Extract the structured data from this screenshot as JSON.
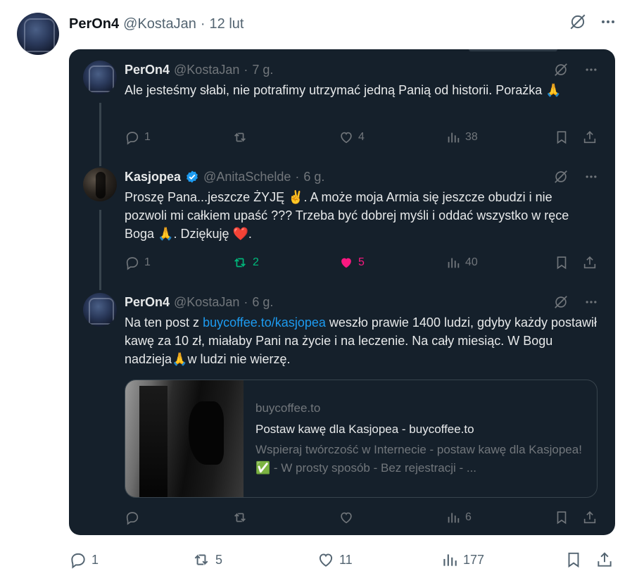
{
  "outer": {
    "name": "PerOn4",
    "handle": "@KostaJan",
    "sep": "·",
    "date": "12 lut",
    "replies": "1",
    "reposts": "5",
    "likes": "11",
    "views": "177"
  },
  "replies": [
    {
      "name": "PerOn4",
      "handle": "@KostaJan",
      "sep": "·",
      "time": "7 g.",
      "text": "Ale jesteśmy słabi, nie potrafimy utrzymać jedną Panią od historii. Porażka 🙏",
      "replies": "1",
      "reposts": "",
      "likes": "4",
      "views": "38"
    },
    {
      "name": "Kasjopea",
      "handle": "@AnitaSchelde",
      "sep": "·",
      "time": "6 g.",
      "text": "Proszę Pana...jeszcze ŻYJĘ ✌️. A może moja Armia się jeszcze obudzi i nie pozwoli mi całkiem upaść  ??? Trzeba być dobrej myśli i oddać wszystko w ręce Boga 🙏. Dziękuję ❤️.",
      "replies": "1",
      "reposts": "2",
      "likes": "5",
      "views": "40"
    },
    {
      "name": "PerOn4",
      "handle": "@KostaJan",
      "sep": "·",
      "time": "6 g.",
      "text_before": "Na ten post z ",
      "link": "buycoffee.to/kasjopea",
      "text_after": " weszło prawie 1400 ludzi, gdyby każdy postawił kawę za 10 zł, miałaby Pani na życie i na leczenie. Na cały miesiąc. W Bogu nadzieja🙏w ludzi nie wierzę.",
      "replies": "",
      "reposts": "",
      "likes": "",
      "views": "6"
    }
  ],
  "card": {
    "domain": "buycoffee.to",
    "title": "Postaw kawę dla Kasjopea - buycoffee.to",
    "description": "Wspieraj twórczość w Internecie - postaw kawę dla Kasjopea! ✅ - W prosty sposób - Bez rejestracji - ..."
  },
  "colors": {
    "embed_bg": "#15202b",
    "link": "#1d9bf0",
    "repost_active": "#00ba7c",
    "like_active": "#f91880",
    "verified": "#1d9bf0"
  },
  "icons": [
    "reply-icon",
    "repost-icon",
    "like-icon",
    "views-icon",
    "bookmark-icon",
    "share-icon",
    "grok-icon",
    "more-icon",
    "verified-badge-icon"
  ]
}
